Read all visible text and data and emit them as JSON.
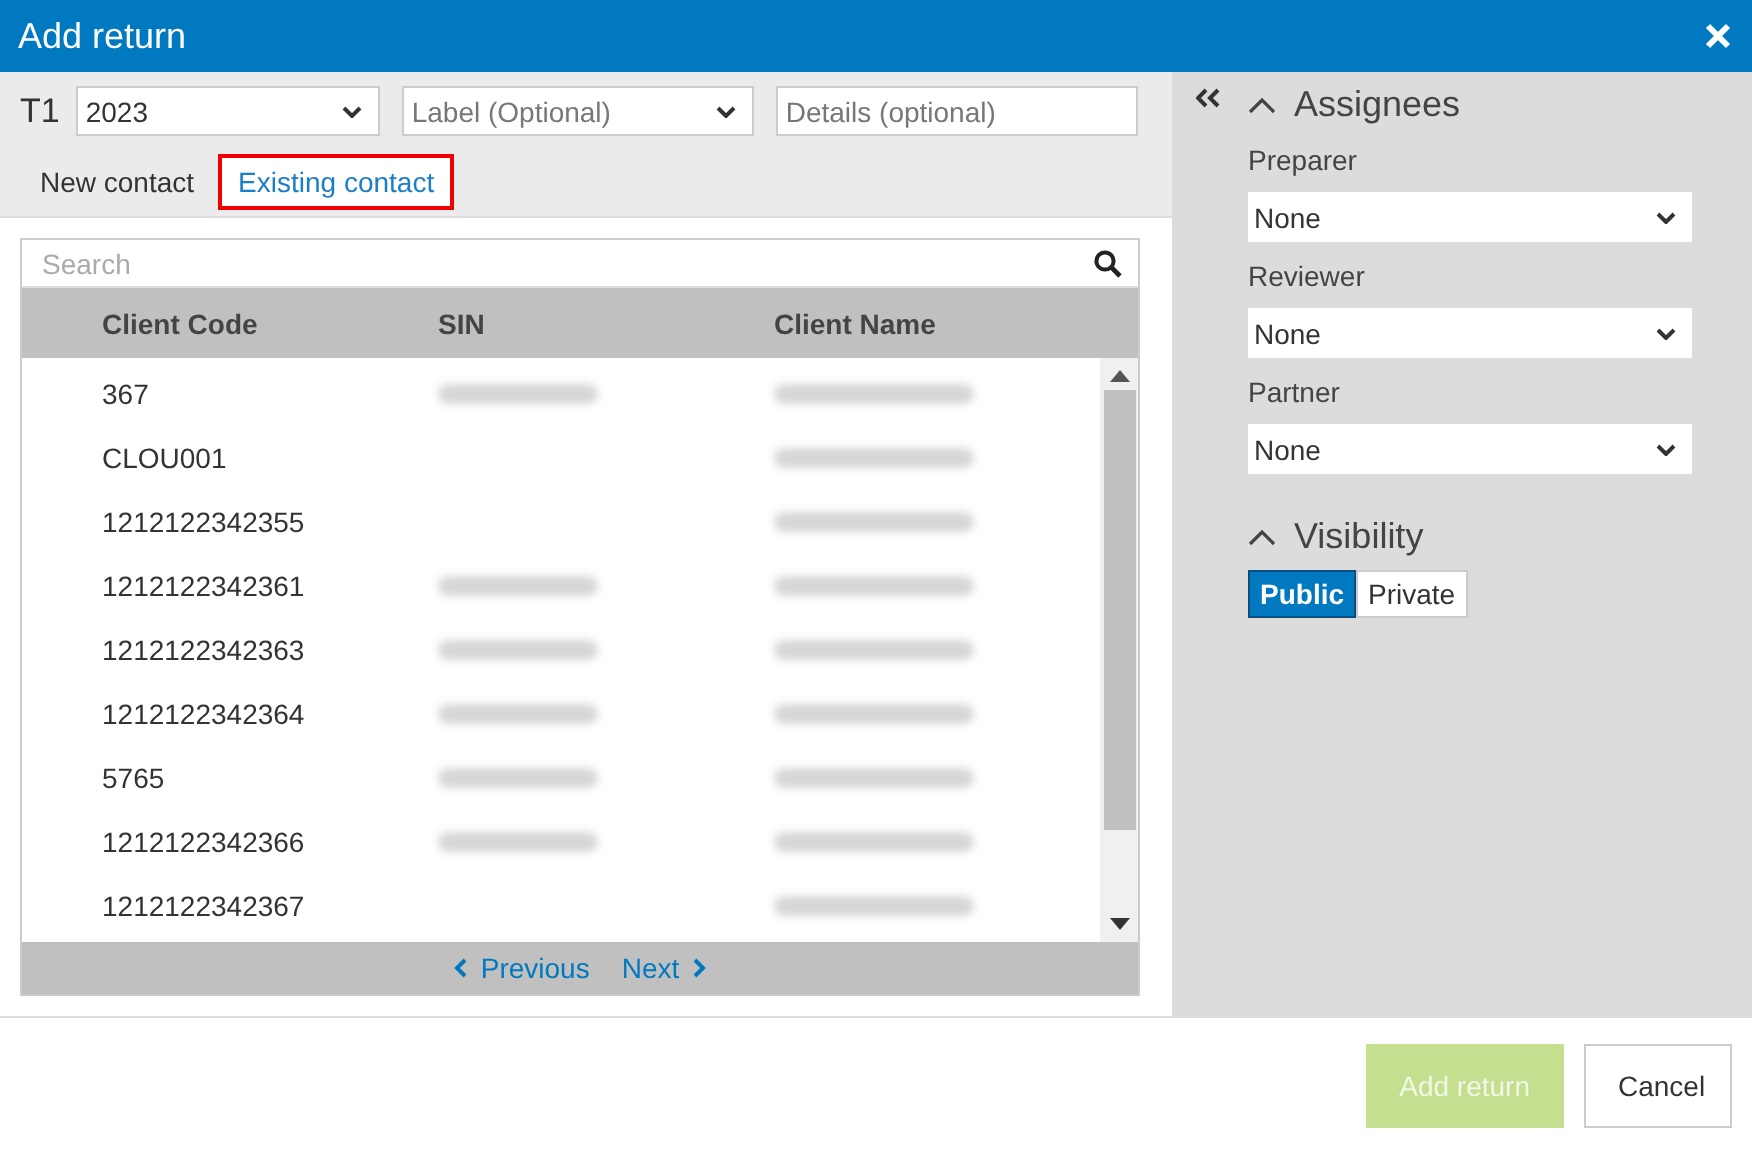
{
  "window": {
    "title": "Add return"
  },
  "return_type": "T1",
  "year_select": {
    "value": "2023"
  },
  "label_select": {
    "placeholder": "Label (Optional)"
  },
  "details_field": {
    "placeholder": "Details (optional)"
  },
  "tabs": [
    {
      "label": "New contact",
      "selected": false
    },
    {
      "label": "Existing contact",
      "selected": true
    }
  ],
  "search": {
    "placeholder": "Search"
  },
  "table": {
    "columns": [
      "Client Code",
      "SIN",
      "Client Name"
    ],
    "rows": [
      {
        "client_code": "367",
        "sin_blurred": true
      },
      {
        "client_code": "CLOU001",
        "sin_blurred": false
      },
      {
        "client_code": "1212122342355",
        "sin_blurred": false
      },
      {
        "client_code": "1212122342361",
        "sin_blurred": true
      },
      {
        "client_code": "1212122342363",
        "sin_blurred": true
      },
      {
        "client_code": "1212122342364",
        "sin_blurred": true
      },
      {
        "client_code": "5765",
        "sin_blurred": true
      },
      {
        "client_code": "1212122342366",
        "sin_blurred": true
      },
      {
        "client_code": "1212122342367",
        "sin_blurred": false
      }
    ]
  },
  "pagination": {
    "previous": "Previous",
    "next": "Next"
  },
  "assignees": {
    "title": "Assignees",
    "expanded": true,
    "fields": [
      {
        "label": "Preparer",
        "value": "None"
      },
      {
        "label": "Reviewer",
        "value": "None"
      },
      {
        "label": "Partner",
        "value": "None"
      }
    ]
  },
  "visibility": {
    "title": "Visibility",
    "expanded": true,
    "options": [
      {
        "label": "Public",
        "selected": true
      },
      {
        "label": "Private",
        "selected": false
      }
    ]
  },
  "buttons": [
    {
      "label": "Add return",
      "kind": "primary",
      "disabled": true
    },
    {
      "label": "Cancel",
      "kind": "secondary",
      "disabled": false
    }
  ]
}
